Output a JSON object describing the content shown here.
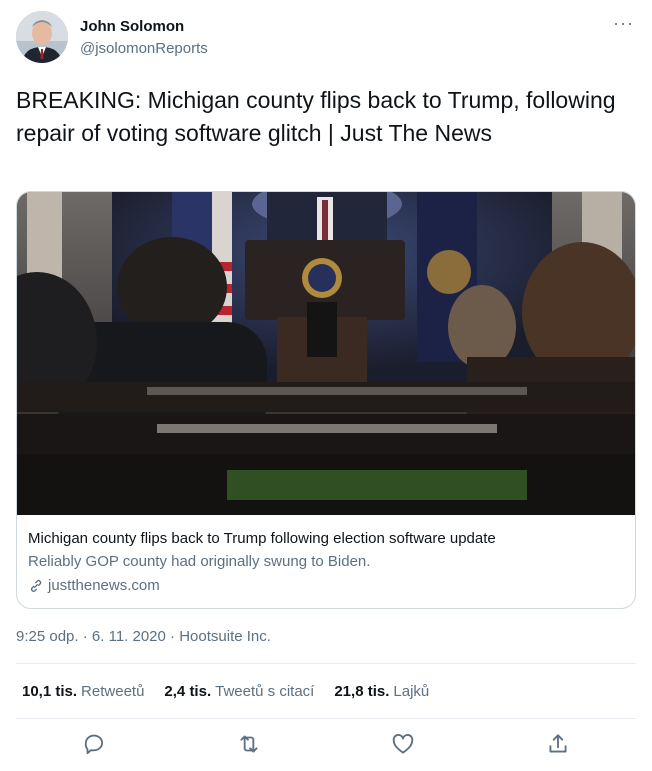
{
  "author": {
    "name": "John Solomon",
    "handle": "@jsolomonReports",
    "avatar_icon": "avatar-photo"
  },
  "more_label": "···",
  "tweet": {
    "text": "BREAKING: Michigan county flips back to Trump, following repair of voting software glitch | Just The News"
  },
  "card": {
    "image_icon": "press-briefing-room-photo",
    "title": "Michigan county flips back to Trump following election software update",
    "description": "Reliably GOP county had originally swung to Biden.",
    "domain": "justthenews.com"
  },
  "meta": {
    "time": "9:25 odp.",
    "sep1": " · ",
    "date": "6. 11. 2020",
    "sep2": " · ",
    "source": "Hootsuite Inc."
  },
  "stats": [
    {
      "count": "10,1 tis.",
      "label": "Retweetů"
    },
    {
      "count": "2,4 tis.",
      "label": "Tweetů s citací"
    },
    {
      "count": "21,8 tis.",
      "label": "Lajků"
    }
  ],
  "actions": [
    "reply-icon",
    "retweet-icon",
    "like-icon",
    "share-icon"
  ],
  "colors": {
    "secondary": "#5b7083",
    "border": "#cfd9de",
    "divider": "#e6ecf0",
    "text": "#0f1419"
  }
}
